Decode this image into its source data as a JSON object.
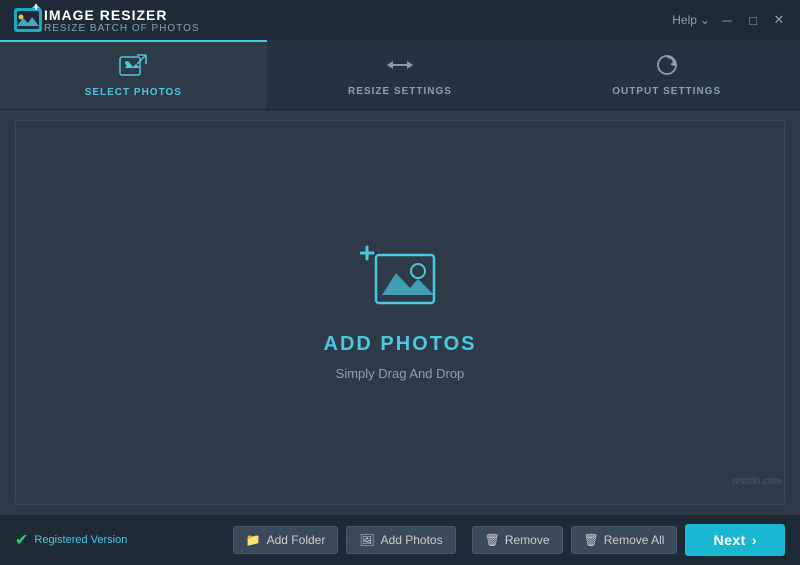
{
  "titlebar": {
    "app_name": "IMAGE RESIZER",
    "app_subtitle": "RESIZE BATCH OF PHOTOS",
    "help_label": "Help",
    "minimize_icon": "─",
    "maximize_icon": "□",
    "close_icon": "✕"
  },
  "tabs": [
    {
      "id": "select-photos",
      "label": "SELECT PHOTOS",
      "active": true
    },
    {
      "id": "resize-settings",
      "label": "RESIZE SETTINGS",
      "active": false
    },
    {
      "id": "output-settings",
      "label": "OUTPUT SETTINGS",
      "active": false
    }
  ],
  "dropzone": {
    "title": "ADD PHOTOS",
    "subtitle": "Simply Drag And Drop"
  },
  "toolbar": {
    "add_folder_label": "Add Folder",
    "add_photos_label": "Add Photos",
    "remove_label": "Remove",
    "remove_all_label": "Remove All",
    "next_label": "Next"
  },
  "status": {
    "label": "Registered Version",
    "check_icon": "✓"
  },
  "watermark": "wscdn.com",
  "colors": {
    "accent": "#4ac8e0",
    "bg_dark": "#1e2a35",
    "bg_main": "#2e3a47",
    "bg_mid": "#253340",
    "btn_next": "#1ab8d0",
    "text_muted": "#8aa0b0"
  }
}
